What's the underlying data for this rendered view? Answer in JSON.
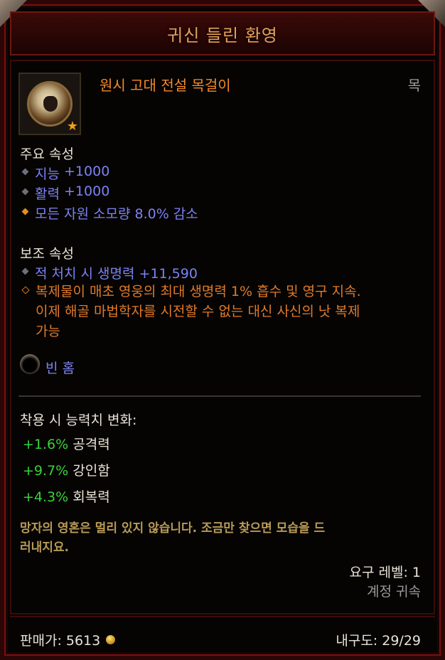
{
  "title": "귀신 들린 환영",
  "item": {
    "name": "원시 고대 전설 목걸이",
    "slot": "목",
    "icon": "amulet-icon"
  },
  "primary": {
    "heading": "주요 속성",
    "attrs": [
      {
        "name": "지능",
        "value": "+1000"
      },
      {
        "name": "활력",
        "value": "+1000"
      },
      {
        "text": "모든 자원 소모량 8.0% 감소"
      }
    ]
  },
  "secondary": {
    "heading": "보조 속성",
    "attrs": [
      {
        "text": "적 처치 시 생명력 +11,590"
      }
    ],
    "legendary_line1": "복제물이 매초 영웅의 최대 생명력 1% 흡수 및 영구 지속.",
    "legendary_line2": "이제 해골 마법학자를 시전할 수 없는 대신 사신의 낫 복제",
    "legendary_line3": "가능"
  },
  "socket": {
    "label": "빈 홈"
  },
  "stat_changes": {
    "heading": "착용 시 능력치 변화:",
    "rows": [
      {
        "delta": "+1.6%",
        "label": "공격력"
      },
      {
        "delta": "+9.7%",
        "label": "강인함"
      },
      {
        "delta": "+4.3%",
        "label": "회복력"
      }
    ]
  },
  "flavor_line1": "망자의 영혼은 멀리 있지 않습니다. 조금만 찾으면 모습을 드",
  "flavor_line2": "러내지요.",
  "requirement": "요구 레벨: 1",
  "binding": "계정 귀속",
  "footer": {
    "sell_label": "판매가: 5613",
    "durability": "내구도: 29/29"
  },
  "colors": {
    "legendary": "#f28a2a",
    "magic": "#7d82f2",
    "positive": "#3bd13b",
    "flavor": "#b89a58"
  }
}
